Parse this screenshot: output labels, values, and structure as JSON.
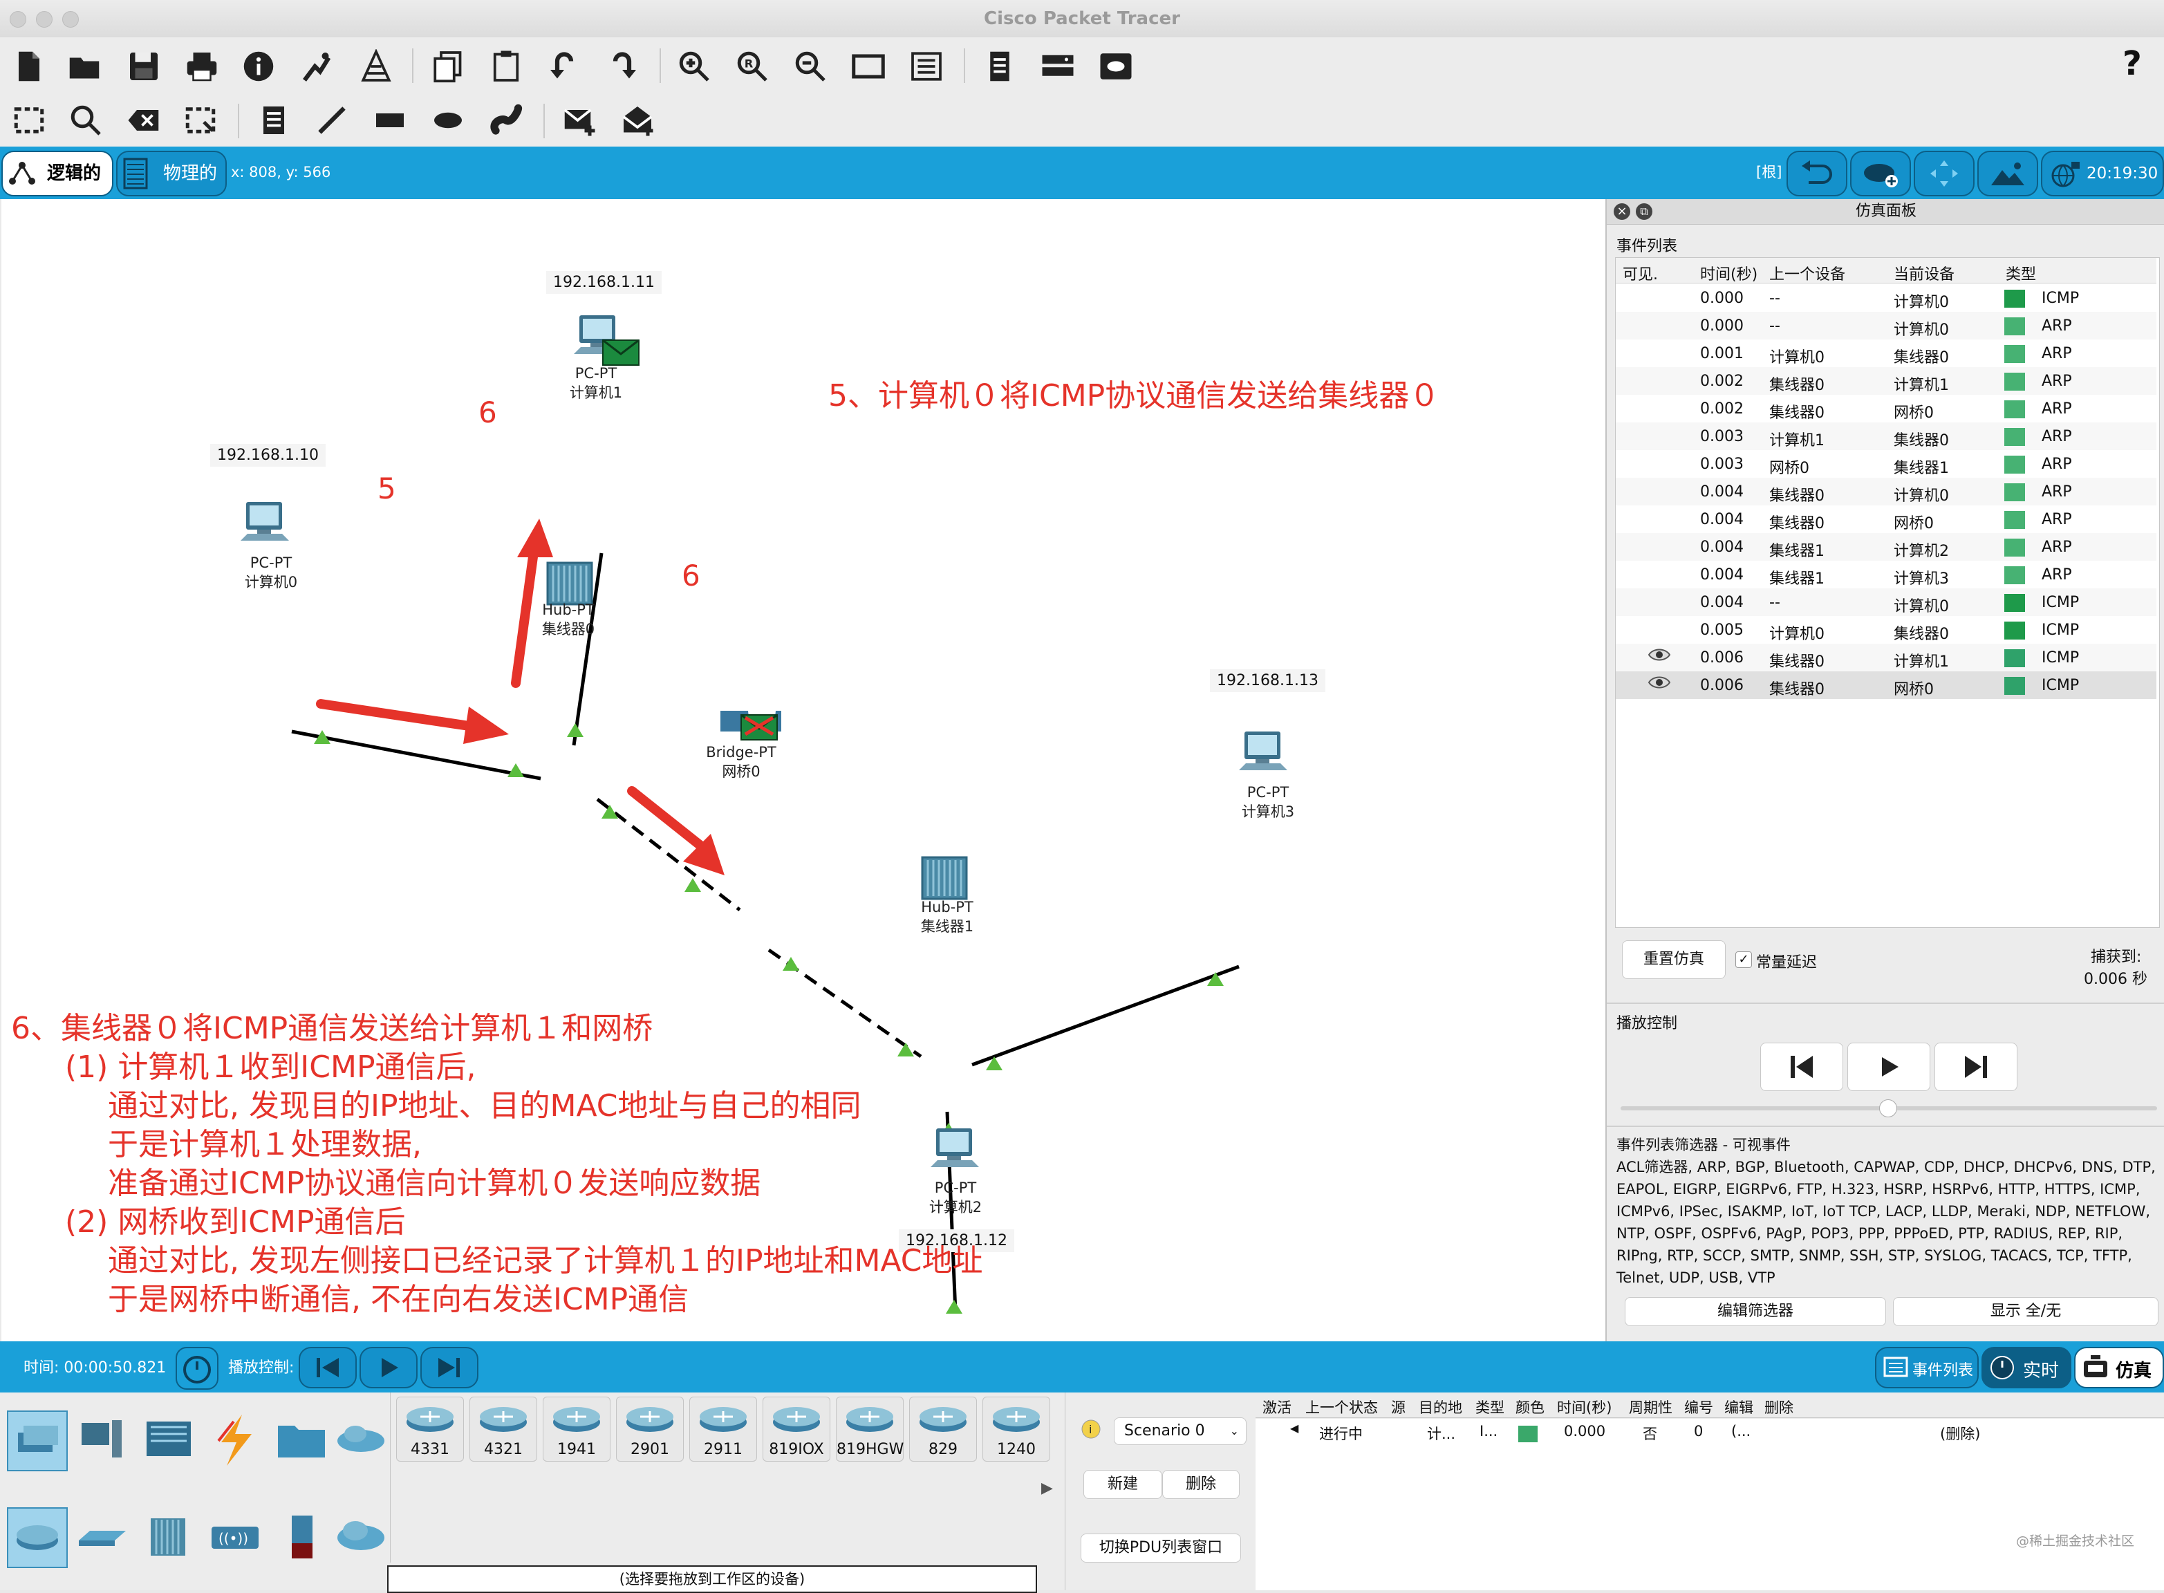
{
  "window": {
    "title": "Cisco Packet Tracer"
  },
  "toolbar": {
    "help": "?"
  },
  "modebar": {
    "logical": "逻辑的",
    "physical": "物理的",
    "coords": "x: 808, y: 566",
    "root": "[根]",
    "clock": "20:19:30"
  },
  "topology": {
    "ips": [
      "192.168.1.11",
      "192.168.1.10",
      "192.168.1.13",
      "192.168.1.12"
    ],
    "devices": [
      {
        "type": "PC-PT",
        "name": "计算机1"
      },
      {
        "type": "PC-PT",
        "name": "计算机0"
      },
      {
        "type": "Hub-PT",
        "name": "集线器0"
      },
      {
        "type": "Bridge-PT",
        "name": "网桥0"
      },
      {
        "type": "PC-PT",
        "name": "计算机3"
      },
      {
        "type": "Hub-PT",
        "name": "集线器1"
      },
      {
        "type": "PC-PT",
        "name": "计算机2"
      }
    ],
    "arrow_labels": [
      "6",
      "5",
      "6"
    ]
  },
  "annotations": {
    "step5": "5、计算机０将ICMP协议通信发送给集线器０",
    "step6_lines": [
      "6、集线器０将ICMP通信发送给计算机１和网桥",
      "(1) 计算机１收到ICMP通信后,",
      "通过对比, 发现目的IP地址、目的MAC地址与自己的相同",
      "于是计算机１处理数据,",
      "准备通过ICMP协议通信向计算机０发送响应数据",
      "(2) 网桥收到ICMP通信后",
      "通过对比, 发现左侧接口已经记录了计算机１的IP地址和MAC地址",
      "于是网桥中断通信, 不在向右发送ICMP通信"
    ]
  },
  "sim_panel": {
    "title": "仿真面板",
    "event_list_label": "事件列表",
    "columns": [
      "可见.",
      "时间(秒)",
      "上一个设备",
      "当前设备",
      "类型"
    ],
    "events": [
      {
        "time": "0.000",
        "prev": "--",
        "cur": "计算机0",
        "type": "ICMP",
        "color": "#1e9a4a",
        "eye": false
      },
      {
        "time": "0.000",
        "prev": "--",
        "cur": "计算机0",
        "type": "ARP",
        "color": "#47b273",
        "eye": false
      },
      {
        "time": "0.001",
        "prev": "计算机0",
        "cur": "集线器0",
        "type": "ARP",
        "color": "#47b273",
        "eye": false
      },
      {
        "time": "0.002",
        "prev": "集线器0",
        "cur": "计算机1",
        "type": "ARP",
        "color": "#47b273",
        "eye": false
      },
      {
        "time": "0.002",
        "prev": "集线器0",
        "cur": "网桥0",
        "type": "ARP",
        "color": "#47b273",
        "eye": false
      },
      {
        "time": "0.003",
        "prev": "计算机1",
        "cur": "集线器0",
        "type": "ARP",
        "color": "#47b273",
        "eye": false
      },
      {
        "time": "0.003",
        "prev": "网桥0",
        "cur": "集线器1",
        "type": "ARP",
        "color": "#47b273",
        "eye": false
      },
      {
        "time": "0.004",
        "prev": "集线器0",
        "cur": "计算机0",
        "type": "ARP",
        "color": "#47b273",
        "eye": false
      },
      {
        "time": "0.004",
        "prev": "集线器0",
        "cur": "网桥0",
        "type": "ARP",
        "color": "#47b273",
        "eye": false
      },
      {
        "time": "0.004",
        "prev": "集线器1",
        "cur": "计算机2",
        "type": "ARP",
        "color": "#47b273",
        "eye": false
      },
      {
        "time": "0.004",
        "prev": "集线器1",
        "cur": "计算机3",
        "type": "ARP",
        "color": "#47b273",
        "eye": false
      },
      {
        "time": "0.004",
        "prev": "--",
        "cur": "计算机0",
        "type": "ICMP",
        "color": "#1e9a4a",
        "eye": false
      },
      {
        "time": "0.005",
        "prev": "计算机0",
        "cur": "集线器0",
        "type": "ICMP",
        "color": "#1e9a4a",
        "eye": false
      },
      {
        "time": "0.006",
        "prev": "集线器0",
        "cur": "计算机1",
        "type": "ICMP",
        "color": "#2fa26a",
        "eye": true
      },
      {
        "time": "0.006",
        "prev": "集线器0",
        "cur": "网桥0",
        "type": "ICMP",
        "color": "#2fa26a",
        "eye": true
      }
    ],
    "reset_button": "重置仿真",
    "constant_delay": "常量延迟",
    "captured_label": "捕获到:",
    "captured_value": "0.006 秒",
    "playback_label": "播放控制",
    "filter_title": "事件列表筛选器 - 可视事件",
    "filter_text": "ACL筛选器, ARP, BGP, Bluetooth, CAPWAP, CDP, DHCP, DHCPv6, DNS, DTP, EAPOL, EIGRP, EIGRPv6, FTP, H.323, HSRP, HSRPv6, HTTP, HTTPS, ICMP, ICMPv6, IPSec, ISAKMP, IoT, IoT TCP, LACP, LLDP, Meraki, NDP, NETFLOW, NTP, OSPF, OSPFv6, PAgP, POP3, PPP, PPPoED, PTP, RADIUS, REP, RIP, RIPng, RTP, SCCP, SMTP, SNMP, SSH, STP, SYSLOG, TACACS, TCP, TFTP, Telnet, UDP, USB, VTP",
    "edit_filter": "编辑筛选器",
    "show_all": "显示 全/无"
  },
  "bottombar": {
    "time": "时间: 00:00:50.821",
    "playback": "播放控制:",
    "event_list": "事件列表",
    "realtime": "实时",
    "simulation": "仿真"
  },
  "device_models": [
    "4331",
    "4321",
    "1941",
    "2901",
    "2911",
    "819IOX",
    "819HGW",
    "829",
    "1240"
  ],
  "device_hint": "(选择要拖放到工作区的设备)",
  "scenario": {
    "selected": "Scenario 0",
    "new": "新建",
    "delete": "删除",
    "toggle_pdu": "切换PDU列表窗口"
  },
  "pdu_table": {
    "columns": [
      "激活",
      "上一个状态",
      "源",
      "目的地",
      "类型",
      "颜色",
      "时间(秒)",
      "周期性",
      "编号",
      "编辑",
      "删除"
    ],
    "row": {
      "status": "进行中",
      "src": "计...",
      "dst": "I...",
      "time": "0.000",
      "periodic": "否",
      "num": "0",
      "edit": "(...",
      "delete": "(删除)",
      "color": "#3aa86a"
    }
  },
  "watermark": "@稀土掘金技术社区"
}
